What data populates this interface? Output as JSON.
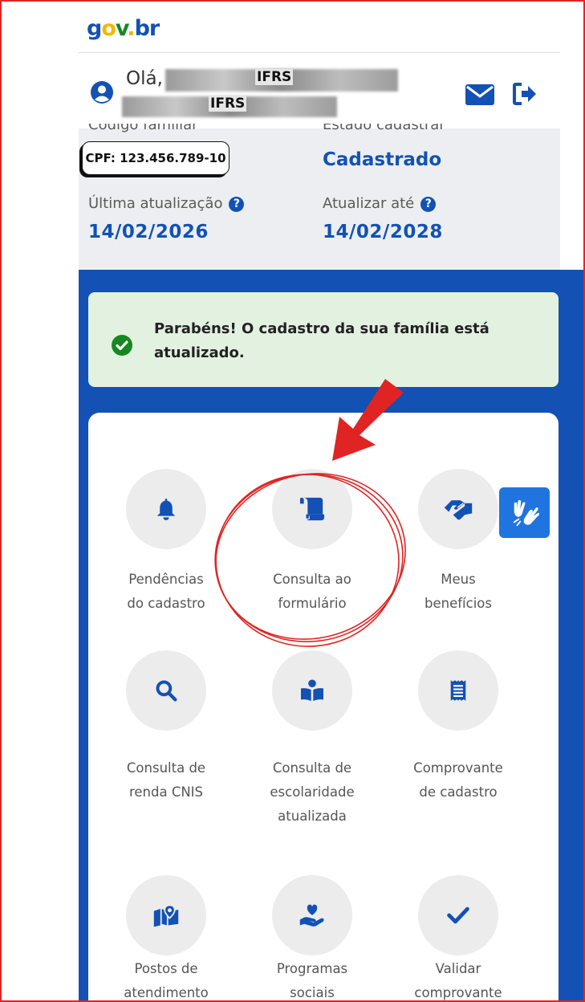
{
  "header": {
    "logo": {
      "g": "g",
      "o": "o",
      "v": "v",
      "dot": ".",
      "br": "br"
    },
    "greeting": "Olá,",
    "masked_name_tag_1": "IFRS",
    "masked_name_tag_2": "IFRS"
  },
  "info": {
    "codigo_familiar_label": "Código familiar",
    "cpf_overlay": "CPF: 123.456.789-10",
    "estado_cadastral_label": "Estado cadastral",
    "estado_cadastral_value": "Cadastrado",
    "ultima_atualizacao_label": "Última atualização",
    "ultima_atualizacao_value": "14/02/2026",
    "atualizar_ate_label": "Atualizar até",
    "atualizar_ate_value": "14/02/2028",
    "help_glyph": "?"
  },
  "alert": {
    "text": "Parabéns! O cadastro da sua família está atualizado."
  },
  "tiles": [
    {
      "label_1": "Pendências",
      "label_2": "do cadastro",
      "label_3": "",
      "icon": "bell-icon"
    },
    {
      "label_1": "Consulta ao",
      "label_2": "formulário",
      "label_3": "",
      "icon": "scroll-icon"
    },
    {
      "label_1": "Meus",
      "label_2": "benefícios",
      "label_3": "",
      "icon": "handshake-icon"
    },
    {
      "label_1": "Consulta de",
      "label_2": "renda CNIS",
      "label_3": "",
      "icon": "search-icon"
    },
    {
      "label_1": "Consulta de",
      "label_2": "escolaridade",
      "label_3": "atualizada",
      "icon": "book-reader-icon"
    },
    {
      "label_1": "Comprovante",
      "label_2": "de cadastro",
      "label_3": "",
      "icon": "receipt-icon"
    },
    {
      "label_1": "Postos de",
      "label_2": "atendimento",
      "label_3": "",
      "icon": "map-pin-icon"
    },
    {
      "label_1": "Programas",
      "label_2": "sociais",
      "label_3": "",
      "icon": "hand-heart-icon"
    },
    {
      "label_1": "Validar",
      "label_2": "comprovante",
      "label_3": "",
      "icon": "check-icon"
    }
  ],
  "colors": {
    "primary_blue": "#1351b4",
    "alert_green_bg": "#e3f1e1",
    "success_green": "#168821",
    "annotation_red": "#e02424"
  }
}
